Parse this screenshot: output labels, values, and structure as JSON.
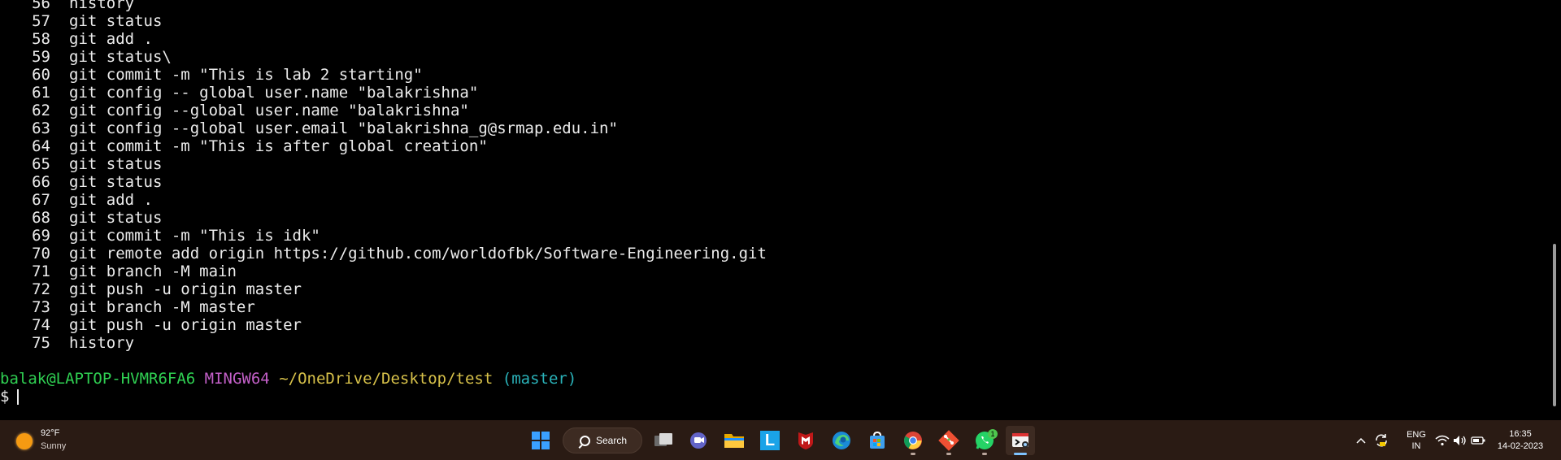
{
  "terminal": {
    "history": [
      {
        "num": "56",
        "cmd": "history"
      },
      {
        "num": "57",
        "cmd": "git status"
      },
      {
        "num": "58",
        "cmd": "git add ."
      },
      {
        "num": "59",
        "cmd": "git status\\"
      },
      {
        "num": "60",
        "cmd": "git commit -m \"This is lab 2 starting\""
      },
      {
        "num": "61",
        "cmd": "git config -- global user.name \"balakrishna\""
      },
      {
        "num": "62",
        "cmd": "git config --global user.name \"balakrishna\""
      },
      {
        "num": "63",
        "cmd": "git config --global user.email \"balakrishna_g@srmap.edu.in\""
      },
      {
        "num": "64",
        "cmd": "git commit -m \"This is after global creation\""
      },
      {
        "num": "65",
        "cmd": "git status"
      },
      {
        "num": "66",
        "cmd": "git status"
      },
      {
        "num": "67",
        "cmd": "git add ."
      },
      {
        "num": "68",
        "cmd": "git status"
      },
      {
        "num": "69",
        "cmd": "git commit -m \"This is idk\""
      },
      {
        "num": "70",
        "cmd": "git remote add origin https://github.com/worldofbk/Software-Engineering.git"
      },
      {
        "num": "71",
        "cmd": "git branch -M main"
      },
      {
        "num": "72",
        "cmd": "git push -u origin master"
      },
      {
        "num": "73",
        "cmd": "git branch -M master"
      },
      {
        "num": "74",
        "cmd": "git push -u origin master"
      },
      {
        "num": "75",
        "cmd": "history"
      }
    ],
    "prompt": {
      "user_host": "balak@LAPTOP-HVMR6FA6",
      "system": "MINGW64",
      "path": "~/OneDrive/Desktop/test",
      "branch": "(master)"
    },
    "input_symbol": "$"
  },
  "taskbar": {
    "weather": {
      "temp": "92°F",
      "condition": "Sunny"
    },
    "search_label": "Search",
    "apps": [
      {
        "name": "start-button",
        "icon": "windows-icon"
      },
      {
        "name": "task-view-button",
        "icon": "task-view-icon"
      },
      {
        "name": "chat-button",
        "icon": "teams-chat-icon"
      },
      {
        "name": "file-explorer-button",
        "icon": "folder-icon"
      },
      {
        "name": "app-l-button",
        "icon": "l-app-icon",
        "letter": "L"
      },
      {
        "name": "mcafee-button",
        "icon": "mcafee-icon"
      },
      {
        "name": "edge-button",
        "icon": "edge-icon"
      },
      {
        "name": "store-button",
        "icon": "store-icon"
      },
      {
        "name": "chrome-button",
        "icon": "chrome-icon"
      },
      {
        "name": "git-gui-button",
        "icon": "git-icon"
      },
      {
        "name": "whatsapp-button",
        "icon": "whatsapp-icon",
        "badge": "1"
      },
      {
        "name": "git-bash-button",
        "icon": "git-bash-icon"
      }
    ],
    "tray": {
      "lang_top": "ENG",
      "lang_bottom": "IN",
      "time": "16:35",
      "date": "14-02-2023"
    }
  },
  "colors": {
    "prompt_user": "#2fcf52",
    "prompt_system": "#c25fc7",
    "prompt_path": "#d8c24a",
    "prompt_branch": "#2ab2b9",
    "taskbar_bg": "#2a1b14"
  }
}
